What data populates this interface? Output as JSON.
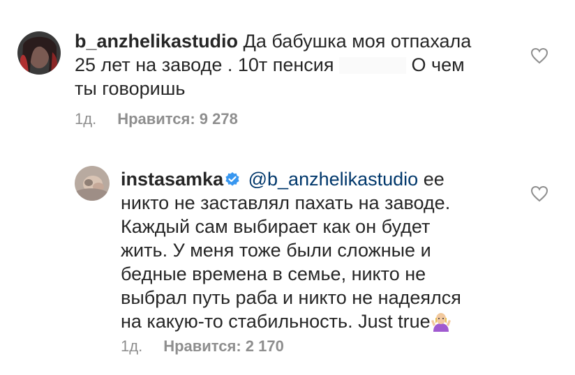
{
  "comments": [
    {
      "username": "b_anzhelikastudio",
      "text_line1": "Да бабушка моя отпахала",
      "text_line2_a": "25 лет на заводе . 10т пенсия",
      "text_line2_b": "О чем",
      "text_line3": "ты говоришь",
      "time": "1д.",
      "likes": "Нравится: 9 278",
      "avatar_icon": "avatar-photo",
      "like_icon": "heart-outline-icon"
    },
    {
      "username": "instasamka",
      "verified_icon": "verified-badge-icon",
      "mention": "@b_anzhelikastudio",
      "text_line1_tail": "ее",
      "lines": [
        "никто не заставлял пахать на заводе.",
        "Каждый сам выбирает как он будет",
        "жить. У меня тоже были сложные и",
        "бедные времена в семье, никто не",
        "выбрал путь раба и никто не надеялся"
      ],
      "last_line": "на какую-то стабильность. Just true",
      "emoji_icon": "person-shrugging-emoji-icon",
      "time": "1д.",
      "likes": "Нравится: 2 170",
      "avatar_icon": "avatar-photo",
      "like_icon": "heart-outline-icon"
    }
  ],
  "colors": {
    "text": "#262626",
    "meta": "#8e8e8e",
    "mention": "#00376b",
    "verified": "#3897f0"
  }
}
